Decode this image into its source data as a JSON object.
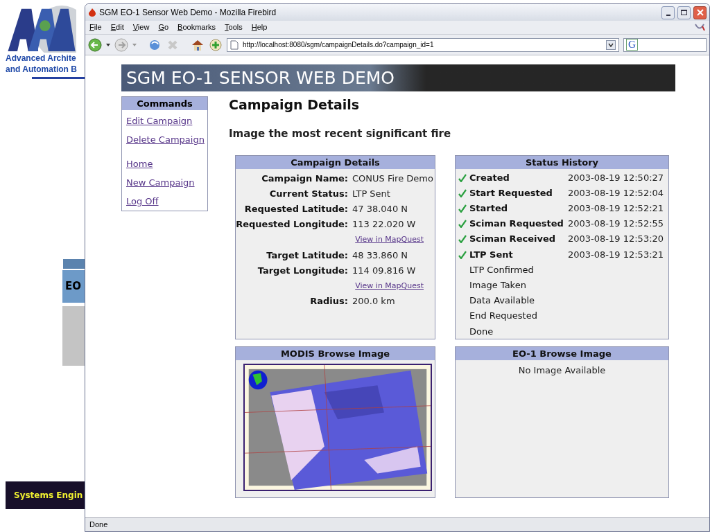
{
  "slide": {
    "logo_lines": [
      "Advanced Archite",
      "and Automation B"
    ],
    "box_label": "EO",
    "banner": "Systems Engin"
  },
  "window": {
    "title": "SGM EO-1 Sensor Web Demo - Mozilla Firebird"
  },
  "menu": [
    "File",
    "Edit",
    "View",
    "Go",
    "Bookmarks",
    "Tools",
    "Help"
  ],
  "address": "http://localhost:8080/sgm/campaignDetails.do?campaign_id=1",
  "search_label": "G",
  "banner_title": "SGM EO-1 SENSOR WEB DEMO",
  "commands": {
    "title": "Commands",
    "groups": [
      [
        "Edit Campaign",
        "Delete Campaign"
      ],
      [
        "Home",
        "New Campaign",
        "Log Off"
      ]
    ]
  },
  "page_title": "Campaign Details",
  "subtitle": "Image the most recent significant fire",
  "details": {
    "title": "Campaign Details",
    "rows": [
      {
        "kind": "field",
        "label": "Campaign Name:",
        "value": "CONUS Fire Demo"
      },
      {
        "kind": "field",
        "label": "Current Status:",
        "value": "LTP Sent"
      },
      {
        "kind": "field",
        "label": "Requested Latitude:",
        "value": "47 38.040 N"
      },
      {
        "kind": "field",
        "label": "Requested Longitude:",
        "value": "113 22.020 W"
      },
      {
        "kind": "link",
        "text": "View in MapQuest"
      },
      {
        "kind": "field",
        "label": "Target Latitude:",
        "value": "48 33.860 N"
      },
      {
        "kind": "field",
        "label": "Target Longitude:",
        "value": "114 09.816 W"
      },
      {
        "kind": "link",
        "text": "View in MapQuest"
      },
      {
        "kind": "field",
        "label": "Radius:",
        "value": "200.0 km"
      }
    ]
  },
  "status_history": {
    "title": "Status History",
    "items": [
      {
        "label": "Created",
        "time": "2003-08-19 12:50:27",
        "done": true
      },
      {
        "label": "Start Requested",
        "time": "2003-08-19 12:52:04",
        "done": true
      },
      {
        "label": "Started",
        "time": "2003-08-19 12:52:21",
        "done": true
      },
      {
        "label": "Sciman Requested",
        "time": "2003-08-19 12:52:55",
        "done": true
      },
      {
        "label": "Sciman Received",
        "time": "2003-08-19 12:53:20",
        "done": true
      },
      {
        "label": "LTP Sent",
        "time": "2003-08-19 12:53:21",
        "done": true
      },
      {
        "label": "LTP Confirmed",
        "done": false
      },
      {
        "label": "Image Taken",
        "done": false
      },
      {
        "label": "Data Available",
        "done": false
      },
      {
        "label": "End Requested",
        "done": false
      },
      {
        "label": "Done",
        "done": false
      }
    ]
  },
  "modis": {
    "title": "MODIS Browse Image"
  },
  "eo1": {
    "title": "EO-1 Browse Image",
    "message": "No Image Available"
  },
  "status_bar": "Done"
}
